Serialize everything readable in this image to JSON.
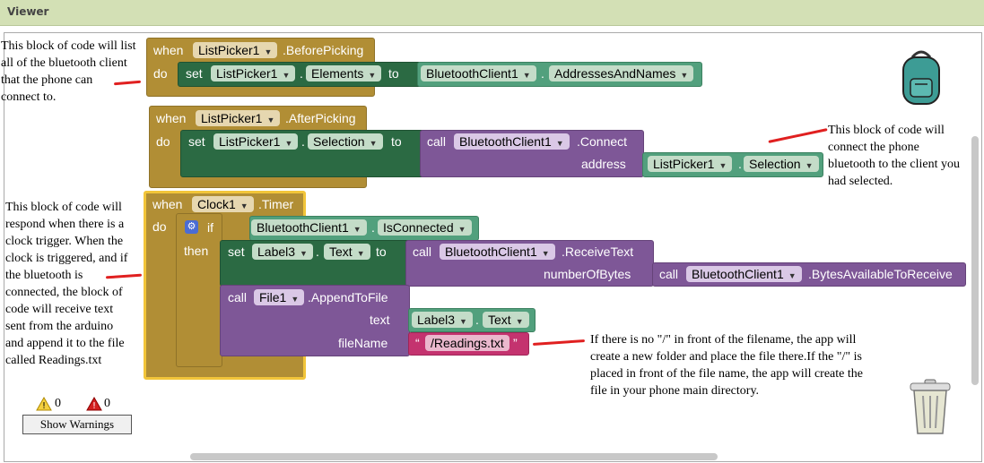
{
  "header": {
    "title": "Viewer"
  },
  "block1": {
    "when": "when",
    "component": "ListPicker1",
    "event": ".BeforePicking",
    "do": "do",
    "set": "set",
    "set_component": "ListPicker1",
    "dot": ".",
    "property": "Elements",
    "to": "to",
    "value_component": "BluetoothClient1",
    "value_property": "AddressesAndNames"
  },
  "block2": {
    "when": "when",
    "component": "ListPicker1",
    "event": ".AfterPicking",
    "do": "do",
    "set": "set",
    "set_component": "ListPicker1",
    "dot": ".",
    "property": "Selection",
    "to": "to",
    "call": "call",
    "call_component": "BluetoothClient1",
    "method": ".Connect",
    "arg_label": "address",
    "arg_component": "ListPicker1",
    "arg_property": "Selection"
  },
  "block3": {
    "when": "when",
    "component": "Clock1",
    "event": ".Timer",
    "do": "do",
    "if": "if",
    "then": "then",
    "cond_component": "BluetoothClient1",
    "cond_property": "IsConnected",
    "set": "set",
    "set_component": "Label3",
    "dot": ".",
    "set_property": "Text",
    "to": "to",
    "call": "call",
    "recv_component": "BluetoothClient1",
    "recv_method": ".ReceiveText",
    "recv_arg": "numberOfBytes",
    "bytes_component": "BluetoothClient1",
    "bytes_method": ".BytesAvailableToReceive",
    "append_component": "File1",
    "append_method": ".AppendToFile",
    "text_label": "text",
    "text_component": "Label3",
    "text_property": "Text",
    "filename_label": "fileName",
    "filename_value": "/Readings.txt",
    "quote_open": "“",
    "quote_close": "”"
  },
  "notes": {
    "n1": [
      "This block of code will list",
      "all of the bluetooth client",
      "that the phone can",
      "connect to."
    ],
    "n2": [
      "This block of code will",
      "connect the phone",
      "bluetooth to the client you",
      "had selected."
    ],
    "n3": [
      "This block of code will",
      "respond when there is a",
      "clock trigger. When the",
      "clock is triggered, and if",
      "the bluetooth is",
      "connected, the block of",
      "code will receive text",
      "sent from the arduino",
      "and append it to the file",
      "called Readings.txt"
    ],
    "n4": [
      "If there is no \"/\" in front of the filename, the app will",
      "create a new folder and place the file there.If the \"/\" is",
      "placed in front of the file name, the app will create the",
      "file in your phone main directory."
    ]
  },
  "warnings": {
    "warning_count": "0",
    "error_count": "0",
    "button_label": "Show Warnings"
  },
  "icons": {
    "backpack": "backpack-icon",
    "trash": "trash-can-icon",
    "warning": "warning-triangle-icon",
    "error": "error-triangle-icon",
    "gear": "gear-icon",
    "dropdown": "dropdown-arrow-icon"
  },
  "colors": {
    "header_bg": "#d3e0b5",
    "event_block": "#b18e35",
    "setter_block": "#2b6a43",
    "method_block": "#7e5797",
    "getter_block": "#52a07d",
    "control_block": "#5b67a5",
    "text_block": "#c4336f",
    "selected_outline": "#f2c53a",
    "annotation_red": "#e02020"
  }
}
